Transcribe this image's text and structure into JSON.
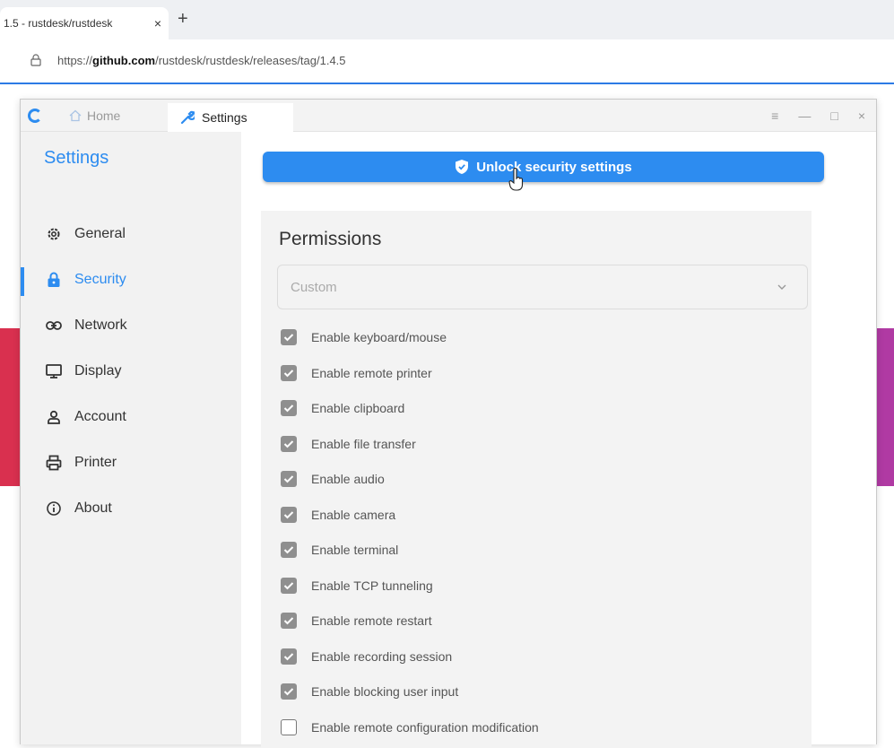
{
  "browser": {
    "tab_title": "1.5 - rustdesk/rustdesk",
    "tab_close": "×",
    "new_tab": "+",
    "url_prefix": "https://",
    "url_domain": "github.com",
    "url_path": "/rustdesk/rustdesk/releases/tag/1.4.5"
  },
  "app": {
    "tabs": {
      "home": "Home",
      "settings": "Settings"
    },
    "controls": {
      "menu": "≡",
      "minimize": "—",
      "maximize": "□",
      "close": "×"
    },
    "sidebar": {
      "title": "Settings",
      "items": [
        {
          "label": "General",
          "icon": "gear-icon",
          "active": false
        },
        {
          "label": "Security",
          "icon": "lock-icon",
          "active": true
        },
        {
          "label": "Network",
          "icon": "link-icon",
          "active": false
        },
        {
          "label": "Display",
          "icon": "monitor-icon",
          "active": false
        },
        {
          "label": "Account",
          "icon": "person-icon",
          "active": false
        },
        {
          "label": "Printer",
          "icon": "printer-icon",
          "active": false
        },
        {
          "label": "About",
          "icon": "info-icon",
          "active": false
        }
      ]
    },
    "unlock_button": "Unlock security settings",
    "permissions": {
      "title": "Permissions",
      "mode": "Custom",
      "items": [
        {
          "label": "Enable keyboard/mouse",
          "checked": true
        },
        {
          "label": "Enable remote printer",
          "checked": true
        },
        {
          "label": "Enable clipboard",
          "checked": true
        },
        {
          "label": "Enable file transfer",
          "checked": true
        },
        {
          "label": "Enable audio",
          "checked": true
        },
        {
          "label": "Enable camera",
          "checked": true
        },
        {
          "label": "Enable terminal",
          "checked": true
        },
        {
          "label": "Enable TCP tunneling",
          "checked": true
        },
        {
          "label": "Enable remote restart",
          "checked": true
        },
        {
          "label": "Enable recording session",
          "checked": true
        },
        {
          "label": "Enable blocking user input",
          "checked": true
        },
        {
          "label": "Enable remote configuration modification",
          "checked": false
        }
      ]
    }
  },
  "colors": {
    "accent": "#2d8cf0",
    "sidebar_bg": "#f2f2f2",
    "card_bg": "#f3f3f3"
  }
}
